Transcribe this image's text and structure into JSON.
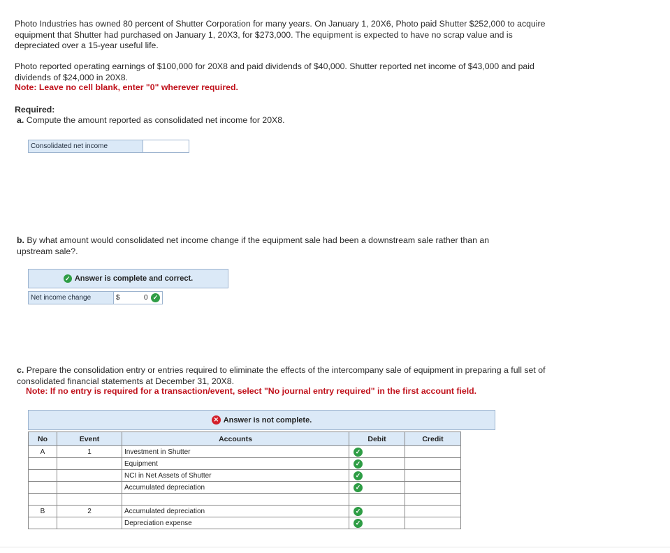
{
  "intro": {
    "p1": "Photo Industries has owned 80 percent of Shutter Corporation for many years. On January 1, 20X6, Photo paid Shutter $252,000 to acquire equipment that Shutter had purchased on January 1, 20X3, for $273,000. The equipment is expected to have no scrap value and is depreciated over a 15-year useful life.",
    "p2": "Photo reported operating earnings of $100,000 for 20X8 and paid dividends of $40,000. Shutter reported net income of $43,000 and paid dividends of $24,000 in 20X8.",
    "note": "Note: Leave no cell blank, enter \"0\" wherever required."
  },
  "required": {
    "heading": "Required:",
    "a_letter": "a.",
    "a_text": "Compute the amount reported as consolidated net income for 20X8.",
    "a_label": "Consolidated net income",
    "a_value": "",
    "b_letter": "b.",
    "b_text": "By what amount would consolidated net income change if the equipment sale had been a downstream sale rather than an upstream sale?.",
    "b_banner": "Answer is complete and correct.",
    "b_label": "Net income change",
    "b_currency": "$",
    "b_value": "0",
    "c_letter": "c.",
    "c_text": "Prepare the consolidation entry or entries required to eliminate the effects of the intercompany sale of equipment in preparing a full set of consolidated financial statements at December 31, 20X8.",
    "c_note": "Note: If no entry is required for a transaction/event, select \"No journal entry required\" in the first account field.",
    "c_banner": "Answer is not complete."
  },
  "table": {
    "headers": {
      "no": "No",
      "event": "Event",
      "accounts": "Accounts",
      "debit": "Debit",
      "credit": "Credit"
    },
    "rows": [
      {
        "no": "A",
        "event": "1",
        "account": "Investment in Shutter",
        "check": true
      },
      {
        "no": "",
        "event": "",
        "account": "Equipment",
        "check": true
      },
      {
        "no": "",
        "event": "",
        "account": "NCI in Net Assets of Shutter",
        "check": true
      },
      {
        "no": "",
        "event": "",
        "account": "Accumulated depreciation",
        "check": true
      },
      {
        "no": "",
        "event": "",
        "account": "",
        "check": false
      },
      {
        "no": "B",
        "event": "2",
        "account": "Accumulated depreciation",
        "check": true
      },
      {
        "no": "",
        "event": "",
        "account": "Depreciation expense",
        "check": true
      }
    ]
  },
  "colors": {
    "accent_bg": "#dbe9f7",
    "note_red": "#c0121c",
    "check_green": "#2e9d45",
    "x_red": "#d3202b"
  }
}
